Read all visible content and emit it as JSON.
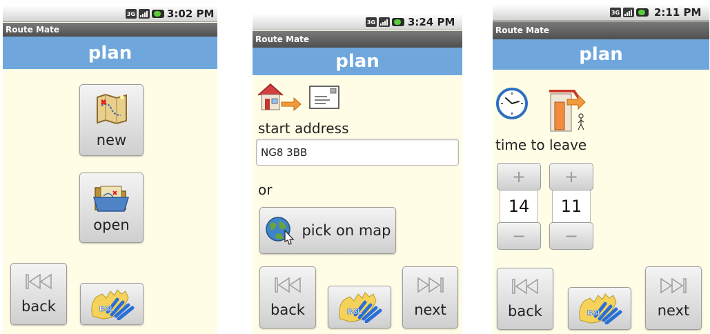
{
  "screens": [
    {
      "status": {
        "time": "3:02 PM",
        "network": "3G"
      },
      "app_name": "Route Mate",
      "title": "plan",
      "new_label": "new",
      "open_label": "open",
      "back_label": "back",
      "bsl_label": "BSL"
    },
    {
      "status": {
        "time": "3:24 PM",
        "network": "3G"
      },
      "app_name": "Route Mate",
      "title": "plan",
      "start_address_label": "start address",
      "start_address_value": "NG8 3BB",
      "or_label": "or",
      "pick_on_map_label": "pick on map",
      "back_label": "back",
      "bsl_label": "BSL",
      "next_label": "next"
    },
    {
      "status": {
        "time": "2:11 PM",
        "network": "3G"
      },
      "app_name": "Route Mate",
      "title": "plan",
      "time_to_leave_label": "time to leave",
      "hour_value": "14",
      "minute_value": "11",
      "plus_symbol": "+",
      "minus_symbol": "−",
      "back_label": "back",
      "bsl_label": "BSL",
      "next_label": "next"
    }
  ],
  "colors": {
    "title_bar": "#6fa7dd",
    "background": "#fffde5",
    "app_bar": "#5a5a5a"
  }
}
